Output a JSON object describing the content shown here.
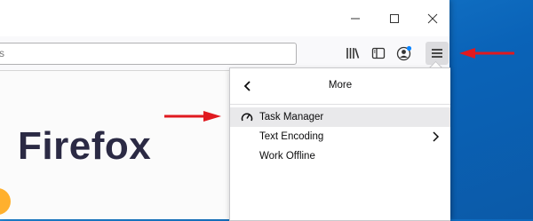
{
  "window": {
    "minimize_icon": "minimize-icon",
    "maximize_icon": "maximize-icon",
    "close_icon": "close-icon"
  },
  "toolbar": {
    "url_text": "s",
    "icons": [
      "library-icon",
      "sidebar-icon",
      "account-icon",
      "hamburger-menu-icon"
    ]
  },
  "content": {
    "logo_text": "Firefox"
  },
  "panel": {
    "title": "More",
    "items": [
      {
        "label": "Task Manager",
        "icon": "gauge-icon",
        "highlighted": true
      },
      {
        "label": "Text Encoding",
        "submenu": true
      },
      {
        "label": "Work Offline"
      }
    ]
  },
  "colors": {
    "annotation_arrow": "#e0191f",
    "desktop": "#0f6ec4"
  }
}
